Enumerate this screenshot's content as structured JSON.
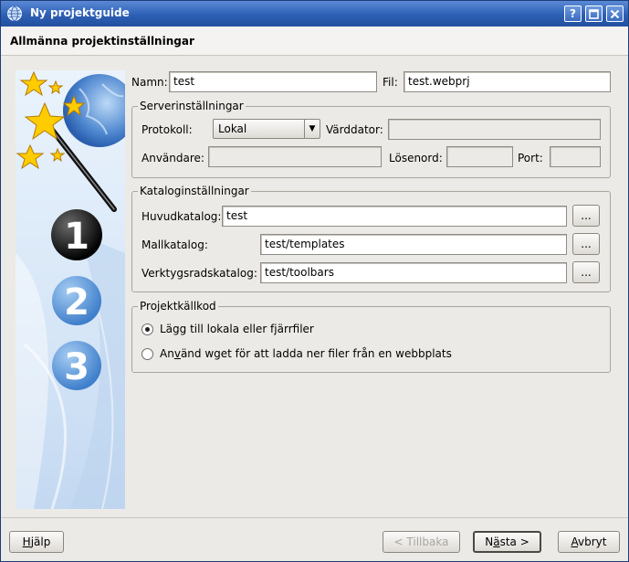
{
  "window": {
    "title": "Ny projektguide",
    "help_button": "?",
    "maximize_button": "□",
    "close_button": "✕",
    "app_icon": "globe-icon"
  },
  "heading": "Allmänna projektinställningar",
  "sidebar": {
    "decoration": "wizard-wand-stars-icon",
    "steps": [
      "1",
      "2",
      "3"
    ],
    "current_step": 1
  },
  "form": {
    "name_label": "Namn:",
    "name_value": "test",
    "file_label": "Fil:",
    "file_value": "test.webprj"
  },
  "server": {
    "title": "Serverinställningar",
    "protocol_label": "Protokoll:",
    "protocol_value": "Lokal",
    "host_label": "Värddator:",
    "user_label": "Användare:",
    "password_label": "Lösenord:",
    "port_label": "Port:"
  },
  "catalog": {
    "title": "Kataloginställningar",
    "main_label": "Huvudkatalog:",
    "main_value": "test",
    "template_label": "Mallkatalog:",
    "template_value": "test/templates",
    "toolbar_label": "Verktygsradskatalog:",
    "toolbar_value": "test/toolbars",
    "browse_label": "..."
  },
  "source": {
    "title": "Projektkällkod",
    "option1_label": "Lägg till lokala eller fjärrfiler",
    "option2_pre": "An",
    "option2_accel": "v",
    "option2_post": "änd wget för att ladda ner filer från en webbplats",
    "selected": 1
  },
  "footer": {
    "help_accel": "H",
    "help_rest": "jälp",
    "back_label": "< Tillbaka",
    "next_pre": "N",
    "next_accel": "ä",
    "next_post": "sta >",
    "cancel_accel": "A",
    "cancel_rest": "vbryt"
  }
}
